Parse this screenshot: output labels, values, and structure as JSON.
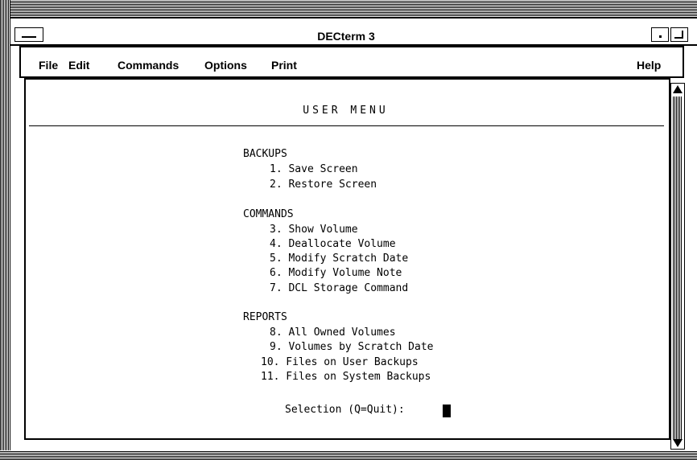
{
  "window": {
    "title": "DECterm 3"
  },
  "menubar": {
    "items": [
      {
        "label": "File"
      },
      {
        "label": "Edit"
      },
      {
        "label": "Commands"
      },
      {
        "label": "Options"
      },
      {
        "label": "Print"
      }
    ],
    "help": {
      "label": "Help"
    }
  },
  "terminal": {
    "heading": "USER MENU",
    "sections": [
      {
        "title": "BACKUPS",
        "items": [
          "1. Save Screen",
          "2. Restore Screen"
        ]
      },
      {
        "title": "COMMANDS",
        "items": [
          "3. Show Volume",
          "4. Deallocate Volume",
          "5. Modify Scratch Date",
          "6. Modify Volume Note",
          "7. DCL Storage Command"
        ]
      },
      {
        "title": "REPORTS",
        "items": [
          "8. All Owned Volumes",
          "9. Volumes by Scratch Date",
          "10. Files on User Backups",
          "11. Files on System Backups"
        ]
      }
    ],
    "prompt": "Selection (Q=Quit):"
  }
}
